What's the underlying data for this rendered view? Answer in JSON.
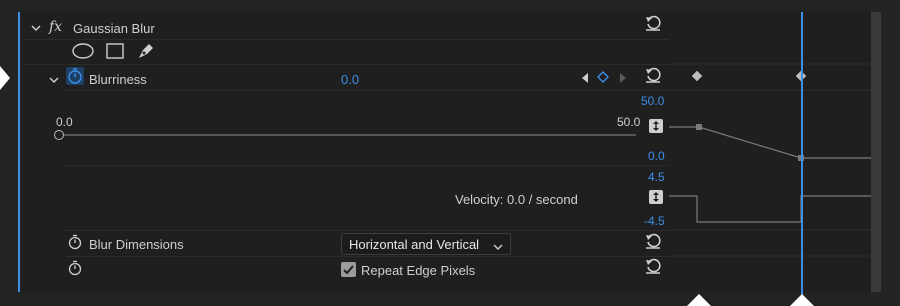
{
  "effect": {
    "name": "Gaussian Blur",
    "fx_label": "fx"
  },
  "blurriness": {
    "label": "Blurriness",
    "value": "0.0",
    "slider_min": "0.0",
    "slider_max": "50.0",
    "slider_fraction": 0.0,
    "value_graph": {
      "max": "50.0",
      "min": "0.0"
    },
    "velocity_graph": {
      "max": "4.5",
      "min": "-4.5",
      "readout": "Velocity: 0.0 / second"
    }
  },
  "blur_dimensions": {
    "label": "Blur Dimensions",
    "value": "Horizontal and Vertical"
  },
  "repeat_edge": {
    "label": "Repeat Edge Pixels",
    "checked": true
  },
  "colors": {
    "accent": "#3b8fe6",
    "panel": "#1f1f1f",
    "background": "#232323"
  }
}
